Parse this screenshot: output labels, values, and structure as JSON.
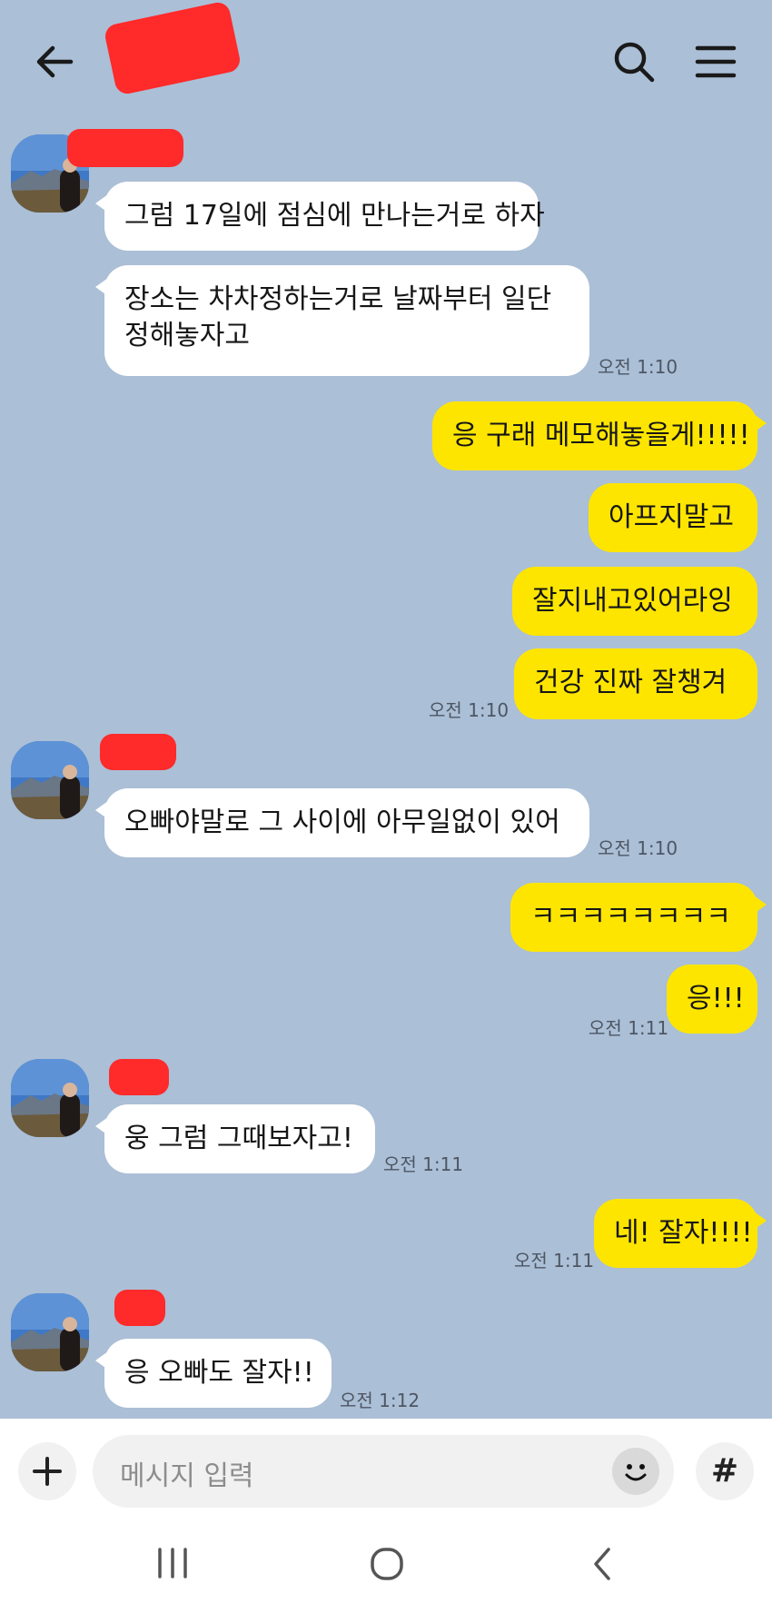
{
  "header": {
    "back_icon": "back-arrow-icon",
    "search_icon": "search-icon",
    "menu_icon": "hamburger-menu-icon"
  },
  "messages": [
    {
      "side": "in",
      "text": "그럼 17일에 점심에 만나는거로 하자"
    },
    {
      "side": "in",
      "lines": [
        "장소는 차차정하는거로 날짜부터 일단",
        "정해놓자고"
      ],
      "time": "오전 1:10"
    },
    {
      "side": "out",
      "text": "응 구래 메모해놓을게!!!!!"
    },
    {
      "side": "out",
      "text": "아프지말고"
    },
    {
      "side": "out",
      "text": "잘지내고있어라잉"
    },
    {
      "side": "out",
      "text": "건강 진짜 잘챙겨",
      "time": "오전 1:10"
    },
    {
      "side": "in",
      "text": "오빠야말로 그 사이에 아무일없이 있어",
      "time": "오전 1:10"
    },
    {
      "side": "out",
      "text": "ㅋㅋㅋㅋㅋㅋㅋㅋ"
    },
    {
      "side": "out",
      "text": "응!!!",
      "time": "오전 1:11"
    },
    {
      "side": "in",
      "text": "웅 그럼 그때보자고!",
      "time": "오전 1:11"
    },
    {
      "side": "out",
      "text": "네! 잘자!!!!",
      "time": "오전 1:11"
    },
    {
      "side": "in",
      "text": "응 오빠도 잘자!!",
      "time": "오전 1:12"
    }
  ],
  "input": {
    "placeholder": "메시지 입력",
    "plus_icon": "plus-icon",
    "emoji_icon": "emoji-icon",
    "hash_icon": "hash-icon",
    "hash_label": "#"
  },
  "colors": {
    "background": "#abbfd6",
    "outgoing_bubble": "#fee500",
    "incoming_bubble": "#ffffff",
    "redaction": "#ff2a2a"
  }
}
